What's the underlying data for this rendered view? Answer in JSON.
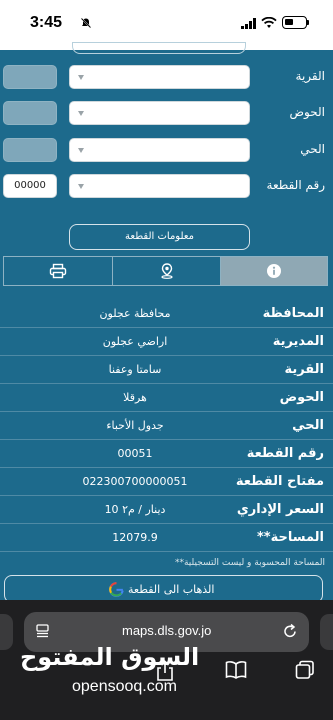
{
  "status": {
    "time": "3:45"
  },
  "form": {
    "rows": [
      {
        "label": "القرية",
        "side": "box"
      },
      {
        "label": "الحوض",
        "side": "box"
      },
      {
        "label": "الحي",
        "side": "box"
      },
      {
        "label": "رقم القطعة",
        "side": "input",
        "input_value": "00000"
      }
    ],
    "info_button_label": "معلومات القطعة"
  },
  "tabs": [
    {
      "icon": "printer-icon",
      "active": false
    },
    {
      "icon": "location-pin-icon",
      "active": false
    },
    {
      "icon": "info-icon",
      "active": true
    }
  ],
  "parcel_info": [
    {
      "key": "المحافظة",
      "value": "محافظة عجلون"
    },
    {
      "key": "المديرية",
      "value": "اراضي عجلون"
    },
    {
      "key": "القرية",
      "value": "سامتا وعفنا"
    },
    {
      "key": "الحوض",
      "value": "هرقلا"
    },
    {
      "key": "الحي",
      "value": "جدول الأحباء"
    },
    {
      "key": "رقم القطعة",
      "value": "00051"
    },
    {
      "key": "مفتاح القطعة",
      "value": "022300700000051"
    },
    {
      "key": "السعر الإداري",
      "value": "10 دينار / م٢"
    },
    {
      "key": "**المساحة",
      "value": "12079.9"
    }
  ],
  "note": "**المساحة المحسوبة و ليست التسجيلية",
  "goto_button_label": "الذهاب الى القطعة",
  "browser": {
    "url": "maps.dls.gov.jo"
  },
  "watermark": {
    "arabic": "السوق المفتوح",
    "latin": "opensooq.com"
  },
  "colors": {
    "primary": "#1d6a8c",
    "active_tab": "#8fa8b4",
    "side_box": "#7fa7ba"
  }
}
